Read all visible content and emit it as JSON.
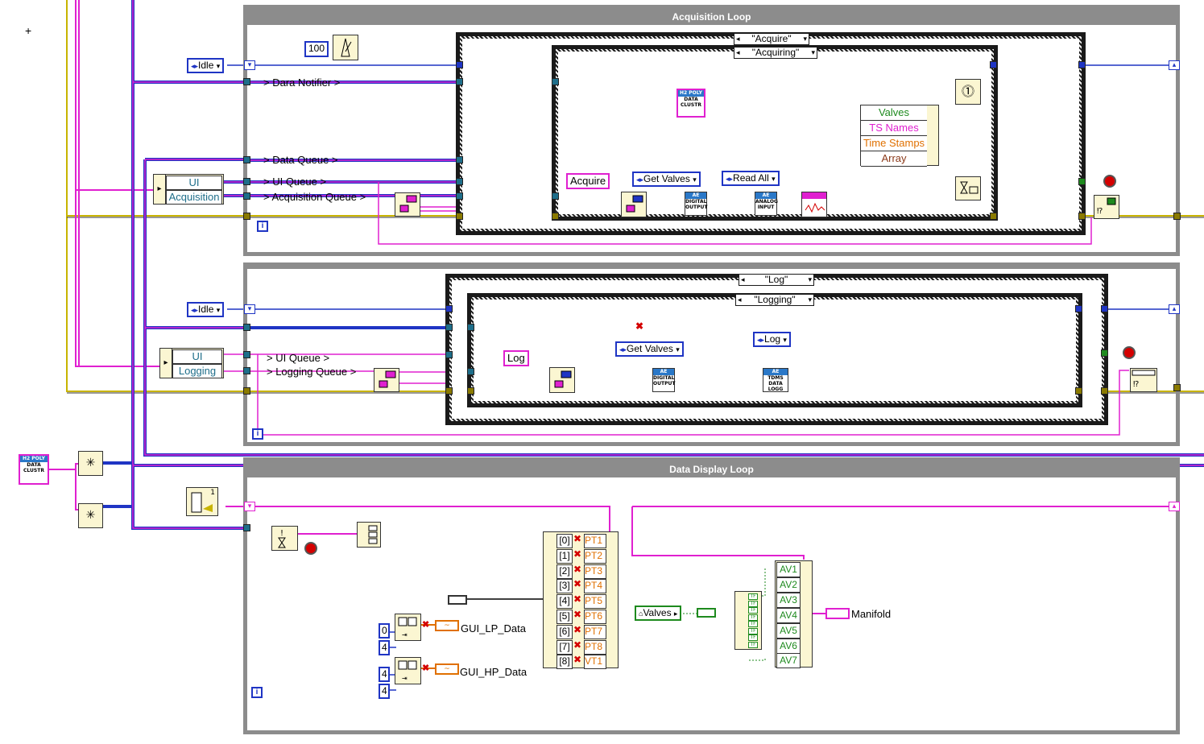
{
  "loops": {
    "acquisition_title": "Acquisition Loop",
    "display_title": "Data Display Loop"
  },
  "acquisition": {
    "idle": "Idle",
    "timer_ms": "100",
    "case_outer": "\"Acquire\"",
    "case_inner": "\"Acquiring\"",
    "labels": [
      "> Dara Notifier >",
      "> Data Queue >",
      "> UI Queue >",
      "> Acquisition Queue >"
    ],
    "cluster_ui": "UI",
    "cluster_acq": "Acquisition",
    "acquire_const": "Acquire",
    "get_valves": "Get Valves",
    "read_all": "Read All",
    "vi_digital_output": "DIGITAL OUTPUT",
    "vi_analog_input": "ANALOG INPUT",
    "vi_data_cluster": "DATA CLUSTR",
    "bundle_rows": [
      "Valves",
      "TS Names",
      "Time Stamps",
      "Array"
    ]
  },
  "logging": {
    "idle": "Idle",
    "case_outer": "\"Log\"",
    "case_inner": "\"Logging\"",
    "labels": [
      "> UI Queue >",
      "> Logging Queue >"
    ],
    "cluster_ui": "UI",
    "cluster_log": "Logging",
    "log_const": "Log",
    "get_valves": "Get Valves",
    "log_enum": "Log",
    "vi_digital_output": "DIGITAL OUTPUT",
    "vi_tdms": "TDMS DATA LOGG"
  },
  "display": {
    "indices": [
      "[0]",
      "[1]",
      "[2]",
      "[3]",
      "[4]",
      "[5]",
      "[6]",
      "[7]",
      "[8]"
    ],
    "pts": [
      "PT1",
      "PT2",
      "PT3",
      "PT4",
      "PT5",
      "PT6",
      "PT7",
      "PT8",
      "VT1"
    ],
    "avs": [
      "AV1",
      "AV2",
      "AV3",
      "AV4",
      "AV5",
      "AV6",
      "AV7"
    ],
    "gui_lp": "GUI_LP_Data",
    "gui_hp": "GUI_HP_Data",
    "lp_consts": [
      "0",
      "4"
    ],
    "hp_consts": [
      "4",
      "4"
    ],
    "valves_local": "Valves",
    "manifold": "Manifold",
    "counter": "1"
  },
  "iter_label": "i",
  "colors": {
    "loop_frame": "#8c8c8c",
    "wire_pink": "#e020d0",
    "wire_blue": "#1f35c4",
    "wire_yellow": "#c8b400",
    "wire_orange": "#e07000",
    "wire_green": "#1e8a1e",
    "error_stop": "#d40000"
  }
}
